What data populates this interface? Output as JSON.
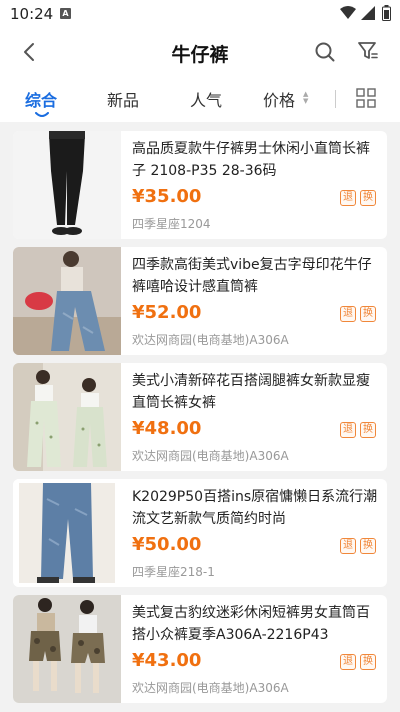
{
  "status": {
    "time": "10:24",
    "notif_letter": "A"
  },
  "header": {
    "title": "牛仔裤"
  },
  "tabs": [
    {
      "label": "综合"
    },
    {
      "label": "新品"
    },
    {
      "label": "人气"
    },
    {
      "label": "价格"
    }
  ],
  "colors": {
    "accent": "#1a6de0",
    "price": "#f07010",
    "badge": "#f0873a"
  },
  "products": [
    {
      "title": "高品质夏款牛仔裤男士休闲小直筒长裤子 2108-P35 28-36码",
      "price": "¥35.00",
      "store": "四季星座1204",
      "badge_return": "退",
      "badge_exchange": "换"
    },
    {
      "title": "四季款高街美式vibe复古字母印花牛仔裤嘻哈设计感直筒裤",
      "price": "¥52.00",
      "store": "欢达网商园(电商基地)A306A",
      "badge_return": "退",
      "badge_exchange": "换"
    },
    {
      "title": "美式小清新碎花百搭阔腿裤女新款显瘦直筒长裤女裤",
      "price": "¥48.00",
      "store": "欢达网商园(电商基地)A306A",
      "badge_return": "退",
      "badge_exchange": "换"
    },
    {
      "title": "K2029P50百搭ins原宿慵懒日系流行潮流文艺新款气质简约时尚",
      "price": "¥50.00",
      "store": "四季星座218-1",
      "badge_return": "退",
      "badge_exchange": "换"
    },
    {
      "title": "美式复古豹纹迷彩休闲短裤男女直筒百搭小众裤夏季A306A-2216P43",
      "price": "¥43.00",
      "store": "欢达网商园(电商基地)A306A",
      "badge_return": "退",
      "badge_exchange": "换"
    }
  ]
}
